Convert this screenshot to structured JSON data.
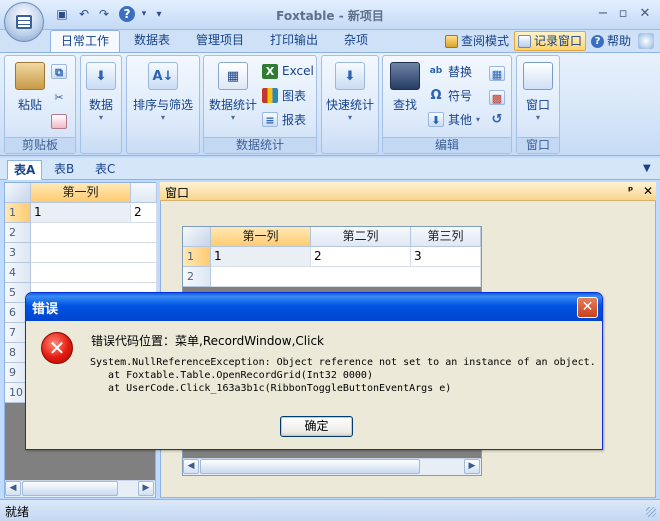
{
  "window": {
    "title": "Foxtable - 新项目",
    "controls": [
      "minimize-icon",
      "restore-icon",
      "close-icon"
    ]
  },
  "quick_access": {
    "icons": [
      "save-icon",
      "undo-icon",
      "redo-icon",
      "help-icon",
      "customize-icon"
    ],
    "menu_glyph": "▾"
  },
  "ribbon_tabs": [
    "日常工作",
    "数据表",
    "管理项目",
    "打印输出",
    "杂项"
  ],
  "active_ribbon_tab": "日常工作",
  "right_tabs": {
    "review_mode": "查阅模式",
    "record_window": "记录窗口",
    "help": "帮助"
  },
  "ribbon": {
    "clipboard": {
      "label": "剪贴板",
      "paste": "粘贴"
    },
    "data": {
      "label": "数据"
    },
    "sort": {
      "label": "排序与筛选"
    },
    "stats": {
      "group_label": "数据统计",
      "button": "数据统计",
      "excel": "Excel",
      "chart": "图表",
      "report": "报表"
    },
    "quickstats": {
      "label": "快速统计"
    },
    "edit": {
      "group_label": "编辑",
      "find": "查找",
      "replace": "替换",
      "symbol": "符号",
      "other": "其他"
    },
    "window": {
      "group_label": "窗口",
      "button": "窗口"
    }
  },
  "sheet_tabs": [
    "表A",
    "表B",
    "表C"
  ],
  "active_sheet": "表A",
  "left_grid": {
    "header": "第一列",
    "row_numbers": [
      "1",
      "2",
      "3",
      "4",
      "5",
      "6",
      "7",
      "8",
      "9",
      "10"
    ],
    "first_row": [
      "1",
      "2"
    ]
  },
  "window_panel": {
    "title": "窗口",
    "pin_glyph": "ᵖ",
    "close_glyph": "✕"
  },
  "inner_grid": {
    "headers": [
      "第一列",
      "第二列",
      "第三列"
    ],
    "row_numbers": [
      "1",
      "2"
    ],
    "first_row": [
      "1",
      "2",
      "3"
    ]
  },
  "dialog": {
    "title": "错误",
    "location": "错误代码位置：菜单,RecordWindow,Click",
    "exception": "System.NullReferenceException: Object reference not set to an instance of an object.",
    "trace1": "   at Foxtable.Table.OpenRecordGrid(Int32 0000)",
    "trace2": "   at UserCode.Click_163a3b1c(RibbonToggleButtonEventArgs e)",
    "ok": "确定"
  },
  "status": {
    "text": "就绪"
  }
}
